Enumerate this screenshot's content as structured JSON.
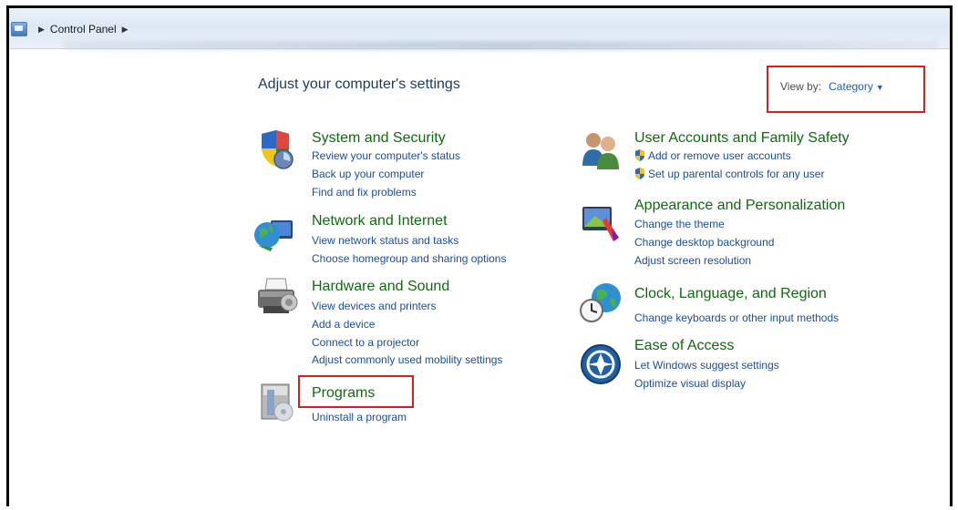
{
  "breadcrumb": {
    "items": [
      "Control Panel"
    ]
  },
  "page_title": "Adjust your computer's settings",
  "view_by": {
    "label": "View by:",
    "value": "Category"
  },
  "left": [
    {
      "title": "System and Security",
      "icon": "shield-icon",
      "links": [
        "Review your computer's status",
        "Back up your computer",
        "Find and fix problems"
      ]
    },
    {
      "title": "Network and Internet",
      "icon": "network-globe-icon",
      "links": [
        "View network status and tasks",
        "Choose homegroup and sharing options"
      ]
    },
    {
      "title": "Hardware and Sound",
      "icon": "printer-icon",
      "links": [
        "View devices and printers",
        "Add a device",
        "Connect to a projector",
        "Adjust commonly used mobility settings"
      ]
    },
    {
      "title": "Programs",
      "icon": "programs-icon",
      "links": [
        "Uninstall a program"
      ]
    }
  ],
  "right": [
    {
      "title": "User Accounts and Family Safety",
      "icon": "users-icon",
      "links": [
        "Add or remove user accounts",
        "Set up parental controls for any user"
      ]
    },
    {
      "title": "Appearance and Personalization",
      "icon": "appearance-icon",
      "links": [
        "Change the theme",
        "Change desktop background",
        "Adjust screen resolution"
      ]
    },
    {
      "title": "Clock, Language, and Region",
      "icon": "clock-globe-icon",
      "links": [
        "Change keyboards or other input methods"
      ]
    },
    {
      "title": "Ease of Access",
      "icon": "ease-of-access-icon",
      "links": [
        "Let Windows suggest settings",
        "Optimize visual display"
      ]
    }
  ],
  "colors": {
    "category_title": "#0e6b0e",
    "link": "#1a4ea5",
    "highlight_box": "#d81e1e"
  }
}
